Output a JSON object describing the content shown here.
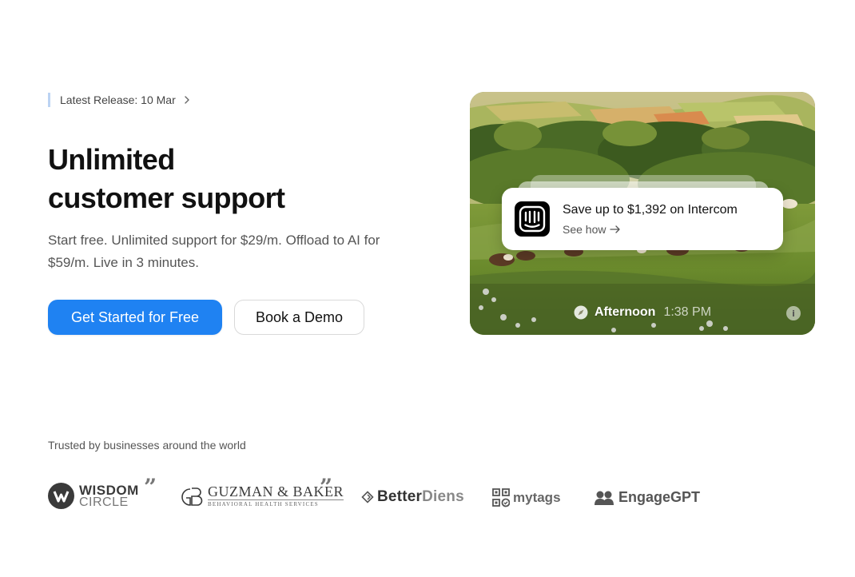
{
  "release": {
    "label": "Latest Release: 10 Mar"
  },
  "hero": {
    "title_line1": "Unlimited",
    "title_line2": "customer support",
    "subtitle": "Start free. Unlimited support for $29/m. Offload to AI for $59/m. Live in 3 minutes.",
    "primary_cta": "Get Started for Free",
    "secondary_cta": "Book a Demo"
  },
  "notification": {
    "title": "Save up to $1,392 on Intercom",
    "link": "See how"
  },
  "status_bar": {
    "label": "Afternoon",
    "time": "1:38 PM",
    "info": "i"
  },
  "trusted": {
    "heading": "Trusted by businesses around the world",
    "logos": {
      "wisdom_top": "WISDOM",
      "wisdom_bottom": "CIRCLE",
      "guzman_top": "GUZMAN & BAKER",
      "guzman_bottom": "BEHAVIORAL HEALTH SERVICES",
      "better_a": "Better",
      "better_b": "Diens",
      "mytags": "mytags",
      "engage": "EngageGPT"
    },
    "quote_mark": "”"
  },
  "colors": {
    "primary": "#1f82f2",
    "text_dark": "#111111",
    "text_muted": "#555555",
    "release_bar": "#bcd3f3"
  },
  "icons": [
    "chevron-right-icon",
    "intercom-icon",
    "arrow-right-icon",
    "compass-icon",
    "info-icon",
    "wisdom-circle-logo",
    "guzman-baker-logo",
    "better-diens-logo",
    "mytags-logo",
    "engagegpt-logo"
  ]
}
